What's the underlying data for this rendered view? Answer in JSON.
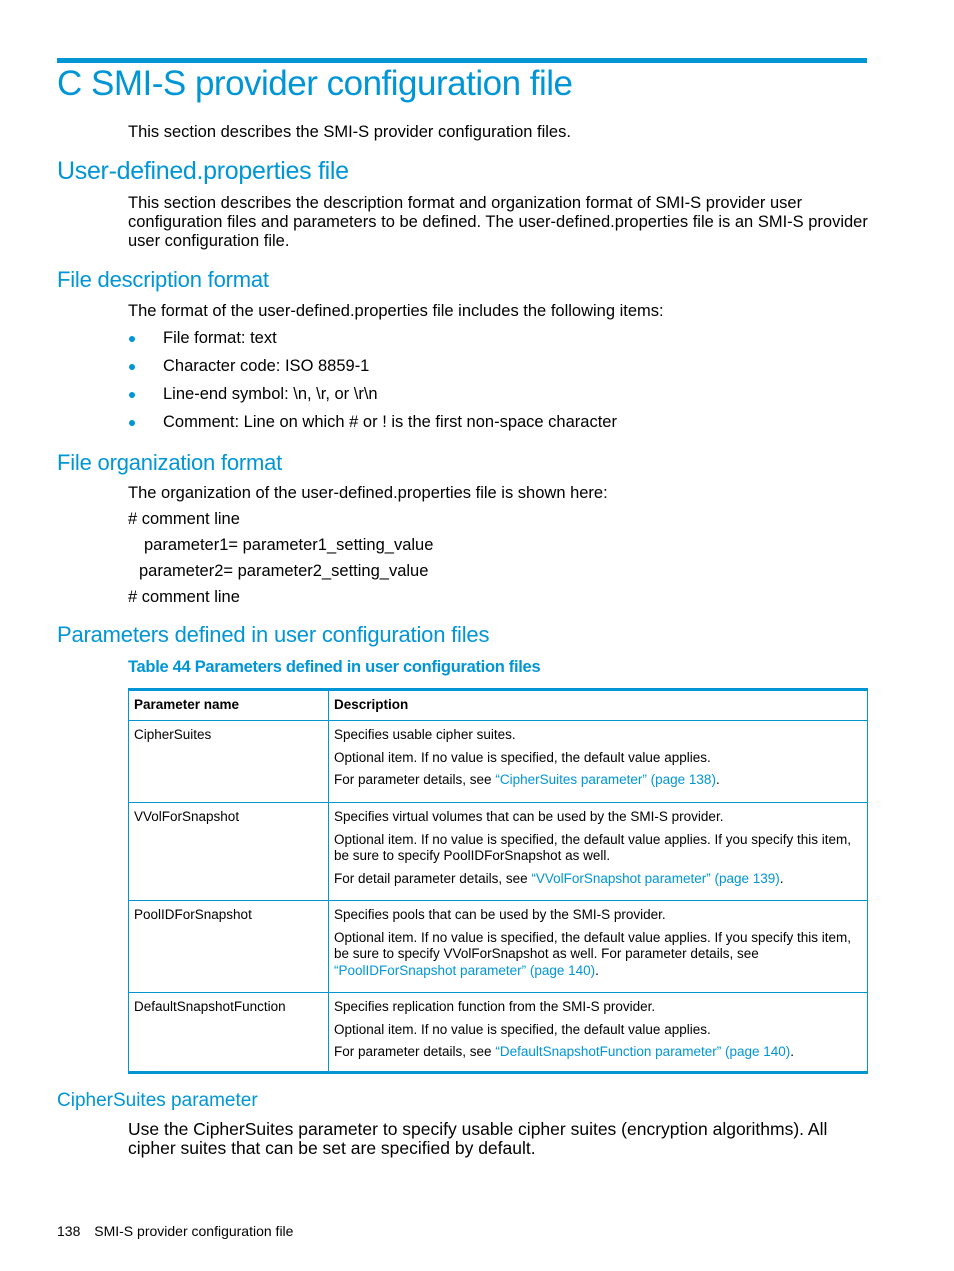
{
  "chapter_title": "C SMI-S provider configuration file",
  "chapter_intro": "This section describes the SMI-S provider configuration files.",
  "section_userdefined": {
    "title": "User-defined.properties file",
    "text": "This section describes the description format and organization format of SMI-S provider user configuration files and parameters to be defined. The user-defined.properties file is an SMI-S provider user configuration file."
  },
  "section_description": {
    "title": "File description format",
    "intro": "The format of the user-defined.properties file includes the following items:",
    "bullets": [
      "File format: text",
      "Character code: ISO 8859-1",
      "Line-end symbol: \\n, \\r, or \\r\\n",
      "Comment: Line on which # or ! is the first non-space character"
    ]
  },
  "section_organization": {
    "title": "File organization format",
    "intro": "The organization of the user-defined.properties file is shown here:",
    "lines": [
      "# comment line",
      "parameter1= parameter1_setting_value",
      "parameter2= parameter2_setting_value",
      "# comment line"
    ]
  },
  "section_parameters": {
    "title": "Parameters defined in user configuration files",
    "table_caption": "Table 44 Parameters defined in user configuration files",
    "headers": [
      "Parameter name",
      "Description"
    ],
    "rows": [
      {
        "name": "CipherSuites",
        "line1": "Specifies usable cipher suites.",
        "line2": "Optional item. If no value is specified, the default value applies.",
        "line3_prefix": "For parameter details, see ",
        "line3_link": "“CipherSuites parameter” (page 138)",
        "line3_suffix": "."
      },
      {
        "name": "VVolForSnapshot",
        "line1": "Specifies virtual volumes that can be used by the SMI-S provider.",
        "line2": "Optional item. If no value is specified, the default value applies. If you specify this item, be sure to specify PoolIDForSnapshot as well.",
        "line3_prefix": "For detail parameter details, see ",
        "line3_link": "“VVolForSnapshot parameter” (page 139)",
        "line3_suffix": "."
      },
      {
        "name": "PoolIDForSnapshot",
        "line1": "Specifies pools that can be used by the SMI-S provider.",
        "line2": "Optional item. If no value is specified, the default value applies. If you specify this item, be sure to specify VVolForSnapshot as well. For parameter details, see ",
        "line2_link": "“PoolIDForSnapshot parameter” (page 140)",
        "line2_suffix": "."
      },
      {
        "name": "DefaultSnapshotFunction",
        "line1": "Specifies replication function from the SMI-S provider.",
        "line2": "Optional item. If no value is specified, the default value applies.",
        "line3_prefix": "For parameter details, see ",
        "line3_link": "“DefaultSnapshotFunction parameter” (page 140)",
        "line3_suffix": "."
      }
    ]
  },
  "section_ciphersuites": {
    "title": "CipherSuites parameter",
    "text": "Use the CipherSuites parameter to specify usable cipher suites (encryption algorithms). All cipher suites that can be set are specified by default."
  },
  "footer": {
    "page_number": "138",
    "running_title": "SMI-S provider configuration file"
  }
}
